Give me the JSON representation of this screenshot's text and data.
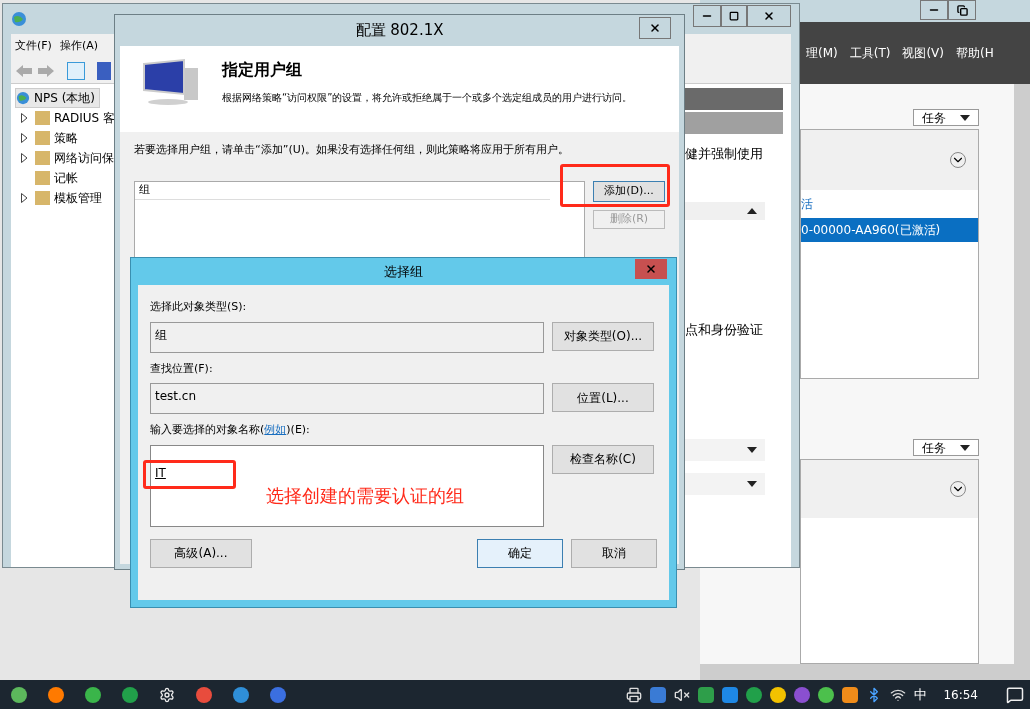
{
  "server_manager": {
    "menu": [
      "理(M)",
      "工具(T)",
      "视图(V)",
      "帮助(H"
    ],
    "tasks_buttons": [
      "任务",
      "任务"
    ],
    "link": "活",
    "rows": [
      {
        "label": "0-00000-AA960(已激活)",
        "selected": true
      }
    ]
  },
  "nps_window": {
    "menu": [
      "文件(F)",
      "操作(A)"
    ],
    "tree": [
      {
        "label": "NPS (本地)",
        "selected": true,
        "children": [
          {
            "label": "RADIUS 客",
            "expandable": true,
            "selected": false
          },
          {
            "label": "策略",
            "expandable": true,
            "selected": false
          },
          {
            "label": "网络访问保",
            "expandable": true,
            "selected": false
          },
          {
            "label": "记帐",
            "expandable": false,
            "selected": false
          },
          {
            "label": "模板管理",
            "expandable": true,
            "selected": false
          }
        ]
      }
    ],
    "pane_texts": [
      "健并强制使用",
      "点和身份验证"
    ]
  },
  "config_dialog": {
    "title": "配置 802.1X",
    "heading": "指定用户组",
    "description": "根据网络策略“访问权限”的设置，将允许或拒绝属于一个或多个选定组成员的用户进行访问。",
    "instruction": "若要选择用户组，请单击“添加”(U)。如果没有选择任何组，则此策略将应用于所有用户。",
    "list_column": "组",
    "buttons": [
      {
        "label": "添加(D)...",
        "disabled": false
      },
      {
        "label": "删除(R)",
        "disabled": true
      }
    ]
  },
  "select_dialog": {
    "title": "选择组",
    "fields": [
      {
        "label": "选择此对象类型(S):",
        "value": "组",
        "button": "对象类型(O)..."
      },
      {
        "label": "查找位置(F):",
        "value": "test.cn",
        "button": "位置(L)..."
      }
    ],
    "name_label": {
      "before": "输入要选择的对象名称(",
      "link": "例如",
      "after": ")(E):"
    },
    "name_value": "IT",
    "check_button": "检查名称(C)",
    "advanced_button": "高级(A)...",
    "ok_button": "确定",
    "cancel_button": "取消"
  },
  "annotation": "选择创建的需要认证的组",
  "taskbar": {
    "ime": "中",
    "time": "16:54"
  }
}
